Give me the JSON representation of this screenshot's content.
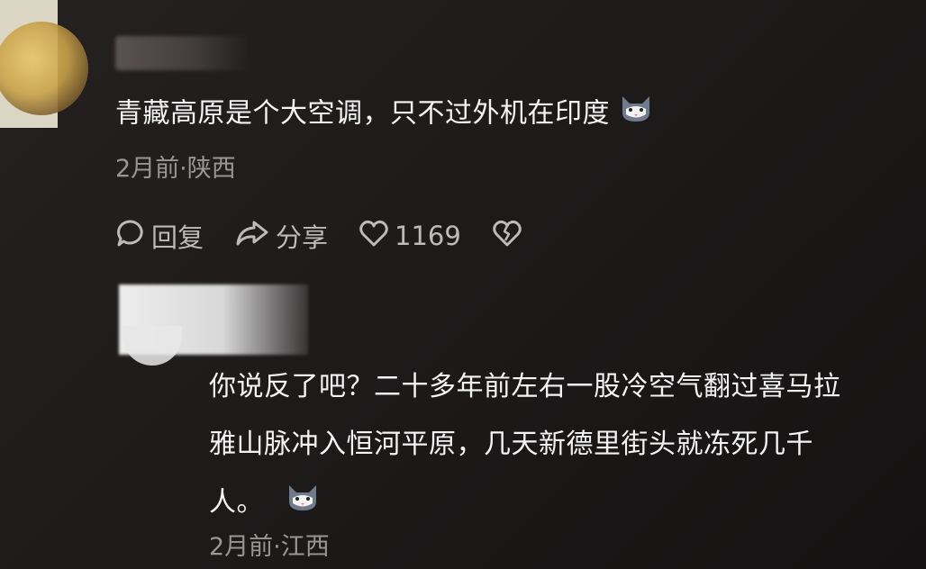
{
  "comment1": {
    "text": "青藏高原是个大空调，只不过外机在印度",
    "emoji": "cat-emoji",
    "meta": "2月前·陕西",
    "actions": {
      "reply_label": "回复",
      "share_label": "分享",
      "like_count": "1169"
    }
  },
  "comment2": {
    "lines": [
      "你说反了吧？二十多年前左右一股冷空气翻过喜马拉",
      "雅山脉冲入恒河平原，几天新德里街头就冻死几千",
      "人。"
    ],
    "emoji": "cat-emoji",
    "meta": "2月前·江西"
  },
  "colors": {
    "background": "#1e1b1b",
    "text": "#f4f4f4",
    "meta": "#9a9696",
    "action": "#bdbaba"
  }
}
